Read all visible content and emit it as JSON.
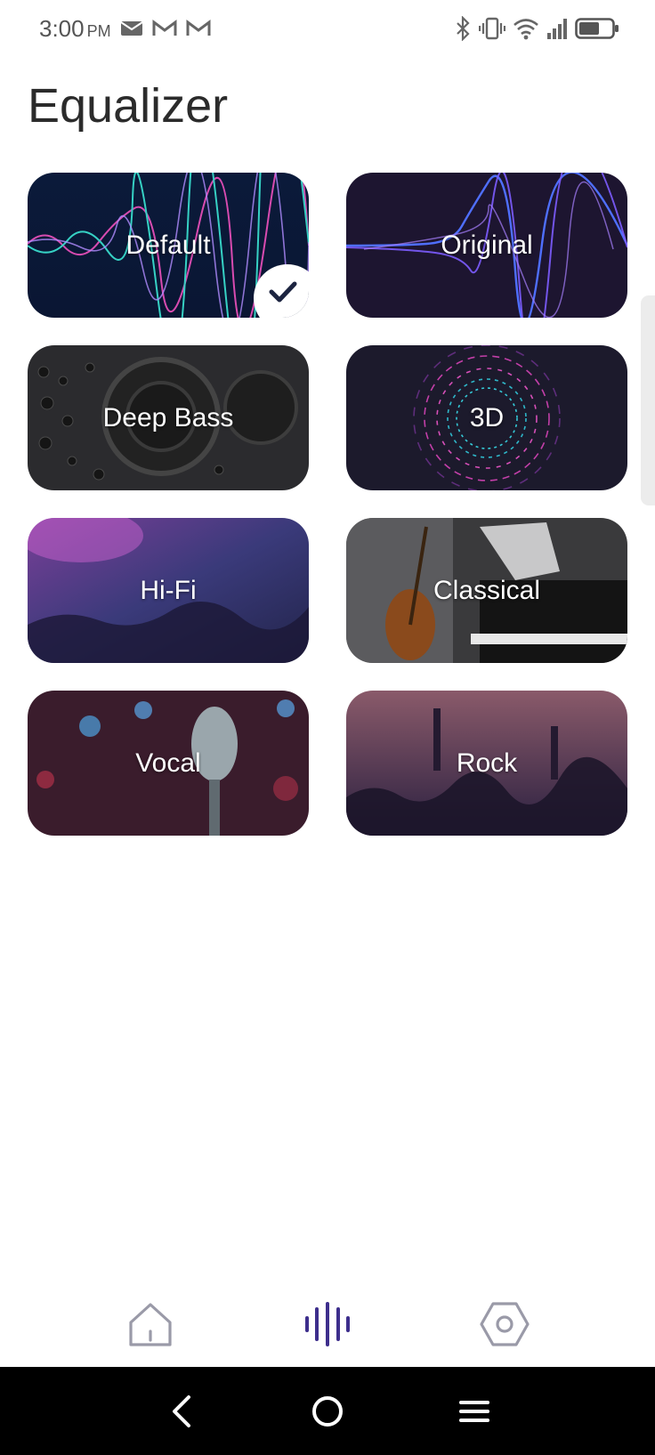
{
  "status_bar": {
    "time": "3:00",
    "ampm": "PM"
  },
  "page": {
    "title": "Equalizer"
  },
  "presets": [
    {
      "label": "Default",
      "selected": true
    },
    {
      "label": "Original",
      "selected": false
    },
    {
      "label": "Deep Bass",
      "selected": false
    },
    {
      "label": "3D",
      "selected": false
    },
    {
      "label": "Hi-Fi",
      "selected": false
    },
    {
      "label": "Classical",
      "selected": false
    },
    {
      "label": "Vocal",
      "selected": false
    },
    {
      "label": "Rock",
      "selected": false
    }
  ],
  "tabs": [
    {
      "name": "home-icon",
      "active": false
    },
    {
      "name": "equalizer-icon",
      "active": true
    },
    {
      "name": "settings-icon",
      "active": false
    }
  ],
  "colors": {
    "accent": "#3d2e8c",
    "inactive_icon": "#9a9aa8",
    "title": "#2b2b2b"
  }
}
